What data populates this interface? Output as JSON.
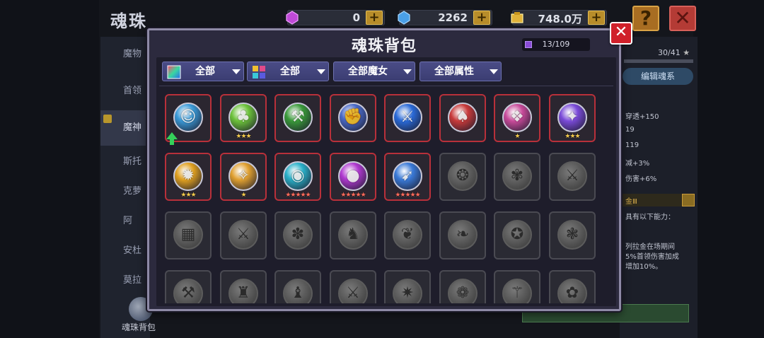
{
  "background": {
    "title": "魂珠",
    "resources": [
      {
        "name": "purple-gem",
        "value": "0",
        "color": "#c04ad8"
      },
      {
        "name": "blue-gem",
        "value": "2262",
        "color": "#4aa0e8"
      },
      {
        "name": "gold",
        "value": "748.0万",
        "color": "#e0b23a"
      }
    ],
    "help": "?",
    "close": "✕",
    "left_menu": [
      "魔物",
      "首领",
      "魔神",
      "斯托",
      "克萝",
      "阿",
      "安杜",
      "莫拉"
    ],
    "bottom_label": "魂珠背包",
    "right_panel": {
      "count": "30/41",
      "star": "★",
      "edit_button": "编辑魂系",
      "lines": [
        "穿透+150",
        "19",
        "119",
        "减+3%",
        "伤害+6%"
      ],
      "gold_label": "金Ⅲ",
      "desc_lines": [
        "具有以下能力：",
        "列拉金在场期间",
        "5%首领伤害加成",
        "增加10%。"
      ]
    }
  },
  "modal": {
    "title": "魂珠背包",
    "capacity": "13/109",
    "close": "✕",
    "filters": [
      {
        "label": "全部",
        "icon": "gradient-square-icon"
      },
      {
        "label": "全部",
        "icon": "grid-color-icon"
      },
      {
        "label": "全部魔女",
        "icon": ""
      },
      {
        "label": "全部属性",
        "icon": ""
      }
    ],
    "items": [
      {
        "state": "owned",
        "glyph": "☺",
        "color": "#3a9ad8",
        "stars": "",
        "upgrade": true
      },
      {
        "state": "owned",
        "glyph": "♣",
        "color": "#6cc23a",
        "stars": "★★★",
        "upgrade": false
      },
      {
        "state": "owned",
        "glyph": "⚒",
        "color": "#3a9a3a",
        "stars": "",
        "upgrade": false
      },
      {
        "state": "owned",
        "glyph": "✊",
        "color": "#4a6ac8",
        "stars": "",
        "upgrade": false
      },
      {
        "state": "owned",
        "glyph": "⚔",
        "color": "#2a6ad8",
        "stars": "",
        "upgrade": false
      },
      {
        "state": "owned",
        "glyph": "♠",
        "color": "#c83a3a",
        "stars": "",
        "upgrade": false
      },
      {
        "state": "owned",
        "glyph": "❖",
        "color": "#c84a9a",
        "stars": "★",
        "upgrade": false
      },
      {
        "state": "owned",
        "glyph": "✦",
        "color": "#7a4ad8",
        "stars": "★★★",
        "upgrade": false
      },
      {
        "state": "owned",
        "glyph": "✹",
        "color": "#e0a020",
        "stars": "★★★",
        "upgrade": false
      },
      {
        "state": "owned",
        "glyph": "✧",
        "color": "#e0a030",
        "stars": "★",
        "upgrade": false
      },
      {
        "state": "owned",
        "glyph": "◉",
        "color": "#2ab0c8",
        "stars": "★★★★★",
        "upgrade": false,
        "red": true
      },
      {
        "state": "owned",
        "glyph": "●",
        "color": "#b03ad0",
        "stars": "★★★★★",
        "upgrade": false,
        "red": true
      },
      {
        "state": "owned",
        "glyph": "➹",
        "color": "#3a7ad8",
        "stars": "★★★★★",
        "upgrade": false,
        "red": true
      },
      {
        "state": "empty",
        "glyph": "❂"
      },
      {
        "state": "empty",
        "glyph": "✾"
      },
      {
        "state": "empty",
        "glyph": "⚔"
      },
      {
        "state": "empty",
        "glyph": "▦"
      },
      {
        "state": "empty",
        "glyph": "⚔"
      },
      {
        "state": "empty",
        "glyph": "✽"
      },
      {
        "state": "empty",
        "glyph": "♞"
      },
      {
        "state": "empty",
        "glyph": "❦"
      },
      {
        "state": "empty",
        "glyph": "❧"
      },
      {
        "state": "empty",
        "glyph": "✪"
      },
      {
        "state": "empty",
        "glyph": "❃"
      },
      {
        "state": "empty",
        "glyph": "⚒"
      },
      {
        "state": "empty",
        "glyph": "♜"
      },
      {
        "state": "empty",
        "glyph": "♝"
      },
      {
        "state": "empty",
        "glyph": "⚔"
      },
      {
        "state": "empty",
        "glyph": "✷"
      },
      {
        "state": "empty",
        "glyph": "❁"
      },
      {
        "state": "empty",
        "glyph": "⚚"
      },
      {
        "state": "empty",
        "glyph": "✿"
      }
    ]
  }
}
